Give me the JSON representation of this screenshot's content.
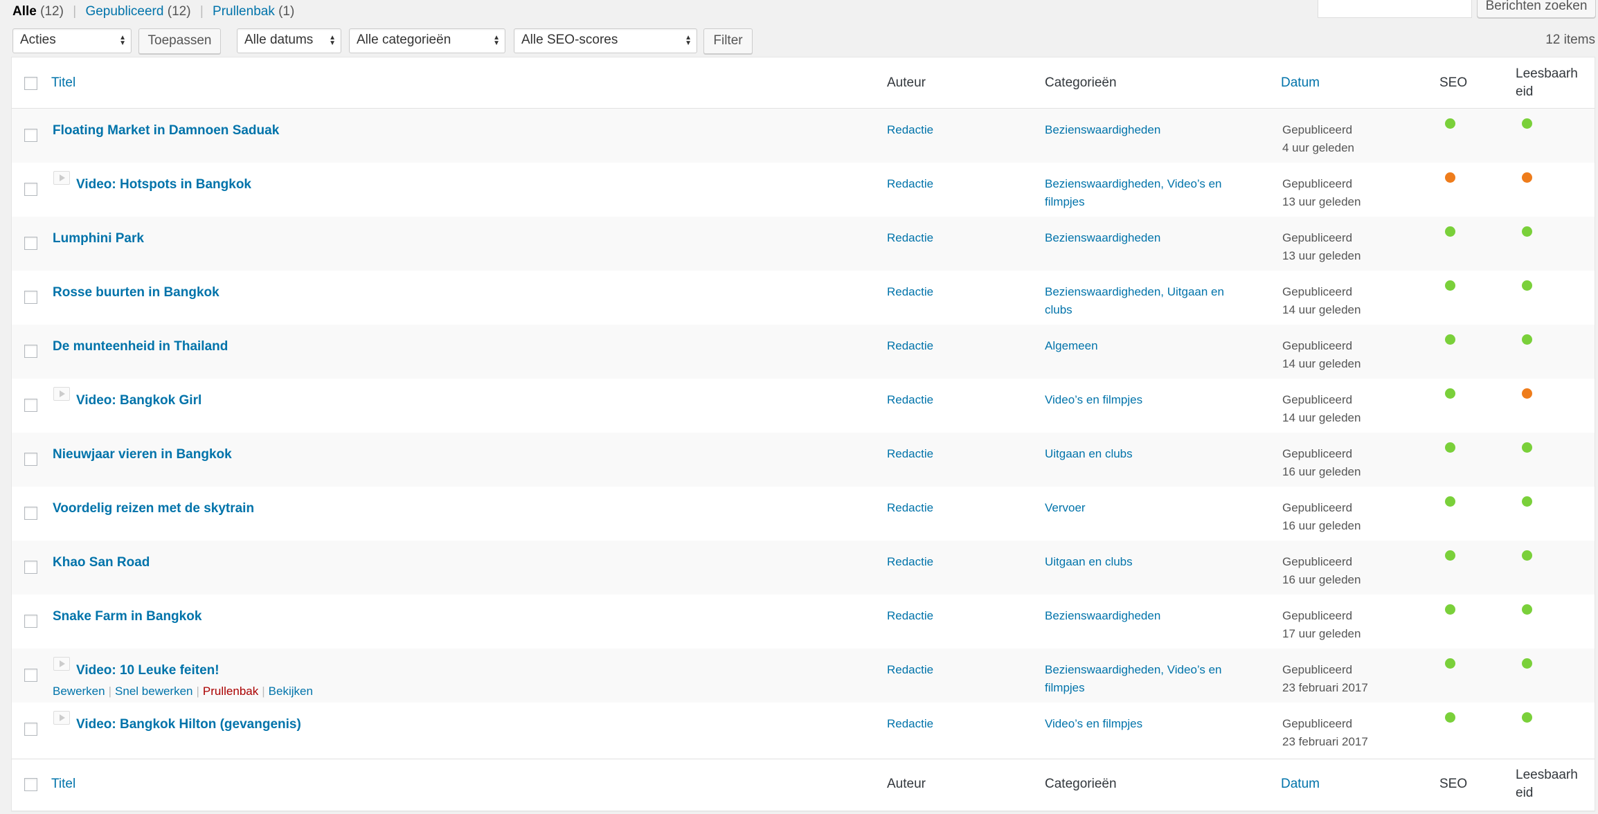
{
  "filters": {
    "all": {
      "label": "Alle",
      "count": "(12)"
    },
    "published": {
      "label": "Gepubliceerd",
      "count": "(12)"
    },
    "trash": {
      "label": "Prullenbak",
      "count": "(1)"
    }
  },
  "search": {
    "value": "",
    "button": "Berichten zoeken"
  },
  "tablenav": {
    "bulk_actions": "Acties",
    "apply": "Toepassen",
    "dates": "Alle datums",
    "categories": "Alle categorieën",
    "seo_scores": "Alle SEO-scores",
    "filter": "Filter",
    "items_count": "12 items"
  },
  "columns": {
    "title": "Titel",
    "author": "Auteur",
    "categories": "Categorieën",
    "date": "Datum",
    "seo": "SEO",
    "readability_line1": "Leesbaarh",
    "readability_line2": "eid"
  },
  "colors": {
    "good": "#7ad03a",
    "ok": "#ee7c1b"
  },
  "rows": [
    {
      "title": "Floating Market in Damnoen Saduak",
      "video": false,
      "author": "Redactie",
      "categories_1": "Bezienswaardigheden",
      "categories_2": "",
      "status": "Gepubliceerd",
      "date": "4 uur geleden",
      "seo": "good",
      "readability": "good"
    },
    {
      "title": "Video: Hotspots in Bangkok",
      "video": true,
      "author": "Redactie",
      "categories_1": "Bezienswaardigheden, Video’s en",
      "categories_2": "filmpjes",
      "status": "Gepubliceerd",
      "date": "13 uur geleden",
      "seo": "ok",
      "readability": "ok"
    },
    {
      "title": "Lumphini Park",
      "video": false,
      "author": "Redactie",
      "categories_1": "Bezienswaardigheden",
      "categories_2": "",
      "status": "Gepubliceerd",
      "date": "13 uur geleden",
      "seo": "good",
      "readability": "good"
    },
    {
      "title": "Rosse buurten in Bangkok",
      "video": false,
      "author": "Redactie",
      "categories_1": "Bezienswaardigheden, Uitgaan en",
      "categories_2": "clubs",
      "status": "Gepubliceerd",
      "date": "14 uur geleden",
      "seo": "good",
      "readability": "good"
    },
    {
      "title": "De munteenheid in Thailand",
      "video": false,
      "author": "Redactie",
      "categories_1": "Algemeen",
      "categories_2": "",
      "status": "Gepubliceerd",
      "date": "14 uur geleden",
      "seo": "good",
      "readability": "good"
    },
    {
      "title": "Video: Bangkok Girl",
      "video": true,
      "author": "Redactie",
      "categories_1": "Video’s en filmpjes",
      "categories_2": "",
      "status": "Gepubliceerd",
      "date": "14 uur geleden",
      "seo": "good",
      "readability": "ok"
    },
    {
      "title": "Nieuwjaar vieren in Bangkok",
      "video": false,
      "author": "Redactie",
      "categories_1": "Uitgaan en clubs",
      "categories_2": "",
      "status": "Gepubliceerd",
      "date": "16 uur geleden",
      "seo": "good",
      "readability": "good"
    },
    {
      "title": "Voordelig reizen met de skytrain",
      "video": false,
      "author": "Redactie",
      "categories_1": "Vervoer",
      "categories_2": "",
      "status": "Gepubliceerd",
      "date": "16 uur geleden",
      "seo": "good",
      "readability": "good"
    },
    {
      "title": "Khao San Road",
      "video": false,
      "author": "Redactie",
      "categories_1": "Uitgaan en clubs",
      "categories_2": "",
      "status": "Gepubliceerd",
      "date": "16 uur geleden",
      "seo": "good",
      "readability": "good"
    },
    {
      "title": "Snake Farm in Bangkok",
      "video": false,
      "author": "Redactie",
      "categories_1": "Bezienswaardigheden",
      "categories_2": "",
      "status": "Gepubliceerd",
      "date": "17 uur geleden",
      "seo": "good",
      "readability": "good"
    },
    {
      "title": "Video: 10 Leuke feiten!",
      "video": true,
      "author": "Redactie",
      "categories_1": "Bezienswaardigheden, Video’s en",
      "categories_2": "filmpjes",
      "status": "Gepubliceerd",
      "date": "23 februari 2017",
      "seo": "good",
      "readability": "good",
      "actions": {
        "edit": "Bewerken",
        "quick_edit": "Snel bewerken",
        "trash": "Prullenbak",
        "view": "Bekijken"
      }
    },
    {
      "title": "Video: Bangkok Hilton (gevangenis)",
      "video": true,
      "author": "Redactie",
      "categories_1": "Video’s en filmpjes",
      "categories_2": "",
      "status": "Gepubliceerd",
      "date": "23 februari 2017",
      "seo": "good",
      "readability": "good"
    }
  ]
}
